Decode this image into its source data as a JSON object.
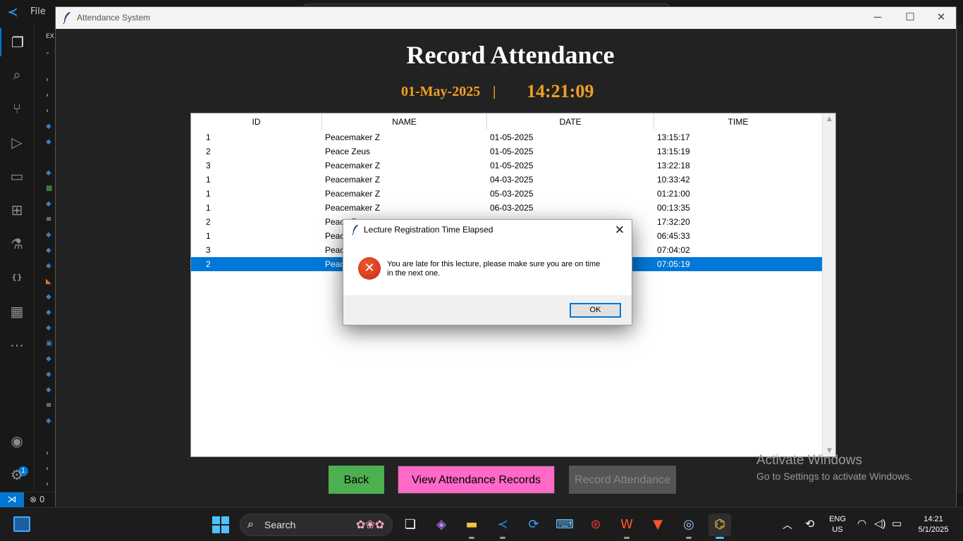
{
  "vscode": {
    "menu_file": "File",
    "sidebar_header": "EX",
    "status_errors": "0"
  },
  "window": {
    "title": "Attendance System",
    "minimize_glyph": "─",
    "maximize_glyph": "☐",
    "close_glyph": "✕"
  },
  "page": {
    "heading": "Record Attendance",
    "date": "01-May-2025",
    "separator": "|",
    "clock": "14:21:09"
  },
  "table": {
    "columns": [
      "ID",
      "NAME",
      "DATE",
      "TIME"
    ],
    "rows": [
      {
        "id": "1",
        "name": "Peacemaker Z",
        "date": "01-05-2025",
        "time": "13:15:17"
      },
      {
        "id": "2",
        "name": "Peace Zeus",
        "date": "01-05-2025",
        "time": "13:15:19"
      },
      {
        "id": "3",
        "name": "Peacemaker Z",
        "date": "01-05-2025",
        "time": "13:22:18"
      },
      {
        "id": "1",
        "name": "Peacemaker Z",
        "date": "04-03-2025",
        "time": "10:33:42"
      },
      {
        "id": "1",
        "name": "Peacemaker Z",
        "date": "05-03-2025",
        "time": "01:21:00"
      },
      {
        "id": "1",
        "name": "Peacemaker Z",
        "date": "06-03-2025",
        "time": "00:13:35"
      },
      {
        "id": "2",
        "name": "Peace Z",
        "date": "",
        "time": "17:32:20"
      },
      {
        "id": "1",
        "name": "Peac",
        "date": "",
        "time": "06:45:33"
      },
      {
        "id": "3",
        "name": "Peac",
        "date": "",
        "time": "07:04:02"
      },
      {
        "id": "2",
        "name": "Peac",
        "date": "",
        "time": "07:05:19"
      }
    ],
    "selected_row": 9
  },
  "buttons": {
    "back": "Back",
    "view_records": "View Attendance Records",
    "record": "Record Attendance"
  },
  "watermark": {
    "title": "Activate Windows",
    "subtitle": "Go to Settings to activate Windows."
  },
  "dialog": {
    "title": "Lecture Registration Time Elapsed",
    "message_line1": "You are late for this lecture, please make sure you are on time",
    "message_line2": "in the next one.",
    "ok": "OK",
    "close_glyph": "✕",
    "icon": "error-icon"
  },
  "taskbar": {
    "search_placeholder": "Search",
    "language_line1": "ENG",
    "language_line2": "US",
    "time": "14:21",
    "date": "5/1/2025"
  },
  "colors": {
    "accent_orange": "#f0a020",
    "selection_blue": "#0078d7",
    "back_green": "#4caf50",
    "view_pink": "#ff69c8",
    "disabled_gray": "#555555"
  }
}
